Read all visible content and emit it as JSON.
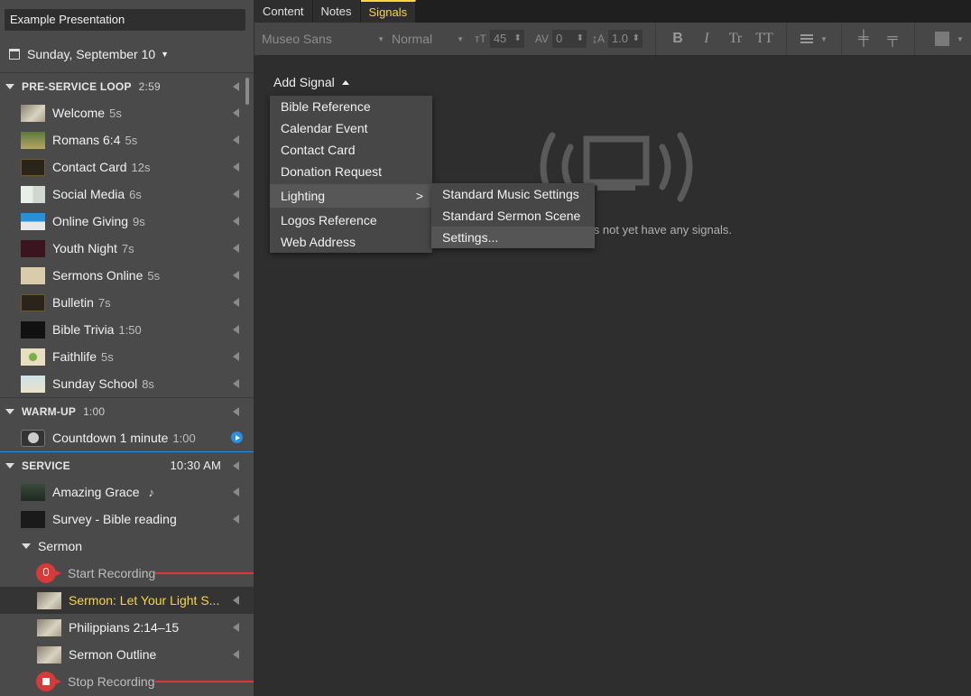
{
  "sidebar": {
    "presentation_title": "Example Presentation",
    "date": "Sunday, September 10",
    "sections": [
      {
        "name": "PRE-SERVICE LOOP",
        "duration": "2:59"
      },
      {
        "name": "WARM-UP",
        "duration": "1:00"
      },
      {
        "name": "SERVICE",
        "time": "10:30 AM"
      }
    ],
    "preservice_items": [
      {
        "name": "Welcome",
        "len": "5s"
      },
      {
        "name": "Romans 6:4",
        "len": "5s"
      },
      {
        "name": "Contact Card",
        "len": "12s"
      },
      {
        "name": "Social Media",
        "len": "6s"
      },
      {
        "name": "Online Giving",
        "len": "9s"
      },
      {
        "name": "Youth Night",
        "len": "7s"
      },
      {
        "name": "Sermons Online",
        "len": "5s"
      },
      {
        "name": "Bulletin",
        "len": "7s"
      },
      {
        "name": "Bible Trivia",
        "len": "1:50"
      },
      {
        "name": "Faithlife",
        "len": "5s"
      },
      {
        "name": "Sunday School",
        "len": "8s"
      }
    ],
    "warmup_items": [
      {
        "name": "Countdown 1 minute",
        "len": "1:00"
      }
    ],
    "service_items": [
      {
        "name": "Amazing Grace",
        "len": "♪"
      },
      {
        "name": "Survey - Bible reading",
        "len": ""
      }
    ],
    "sermon_group": "Sermon",
    "sermon_items": {
      "start_recording": "Start Recording",
      "sermon_title": "Sermon: Let Your Light S...",
      "philippians": "Philippians 2:14–15",
      "outline": "Sermon Outline",
      "stop_recording": "Stop Recording"
    }
  },
  "tabs": [
    "Content",
    "Notes",
    "Signals"
  ],
  "active_tab": "Signals",
  "toolbar": {
    "font": "Museo Sans",
    "style": "Normal",
    "size": "45",
    "tracking": "0",
    "leading": "1.0",
    "size_icon": "ᴛT",
    "tracking_icon": "AV",
    "leading_icon": "↨A",
    "bold": "B",
    "italic": "I",
    "tr": "Tr",
    "tt": "TT"
  },
  "add_signal_label": "Add Signal",
  "menu": {
    "items": [
      "Bible Reference",
      "Calendar Event",
      "Contact Card",
      "Donation Request",
      "Lighting",
      "Logos Reference",
      "Web Address"
    ],
    "lighting_submenu": [
      "Standard Music Settings",
      "Standard Sermon Scene",
      "Settings..."
    ]
  },
  "empty_message": "oes not yet have any signals.",
  "colors": {
    "accent": "#f5d742",
    "record": "#d83a3a",
    "blue": "#2a8fd9"
  }
}
